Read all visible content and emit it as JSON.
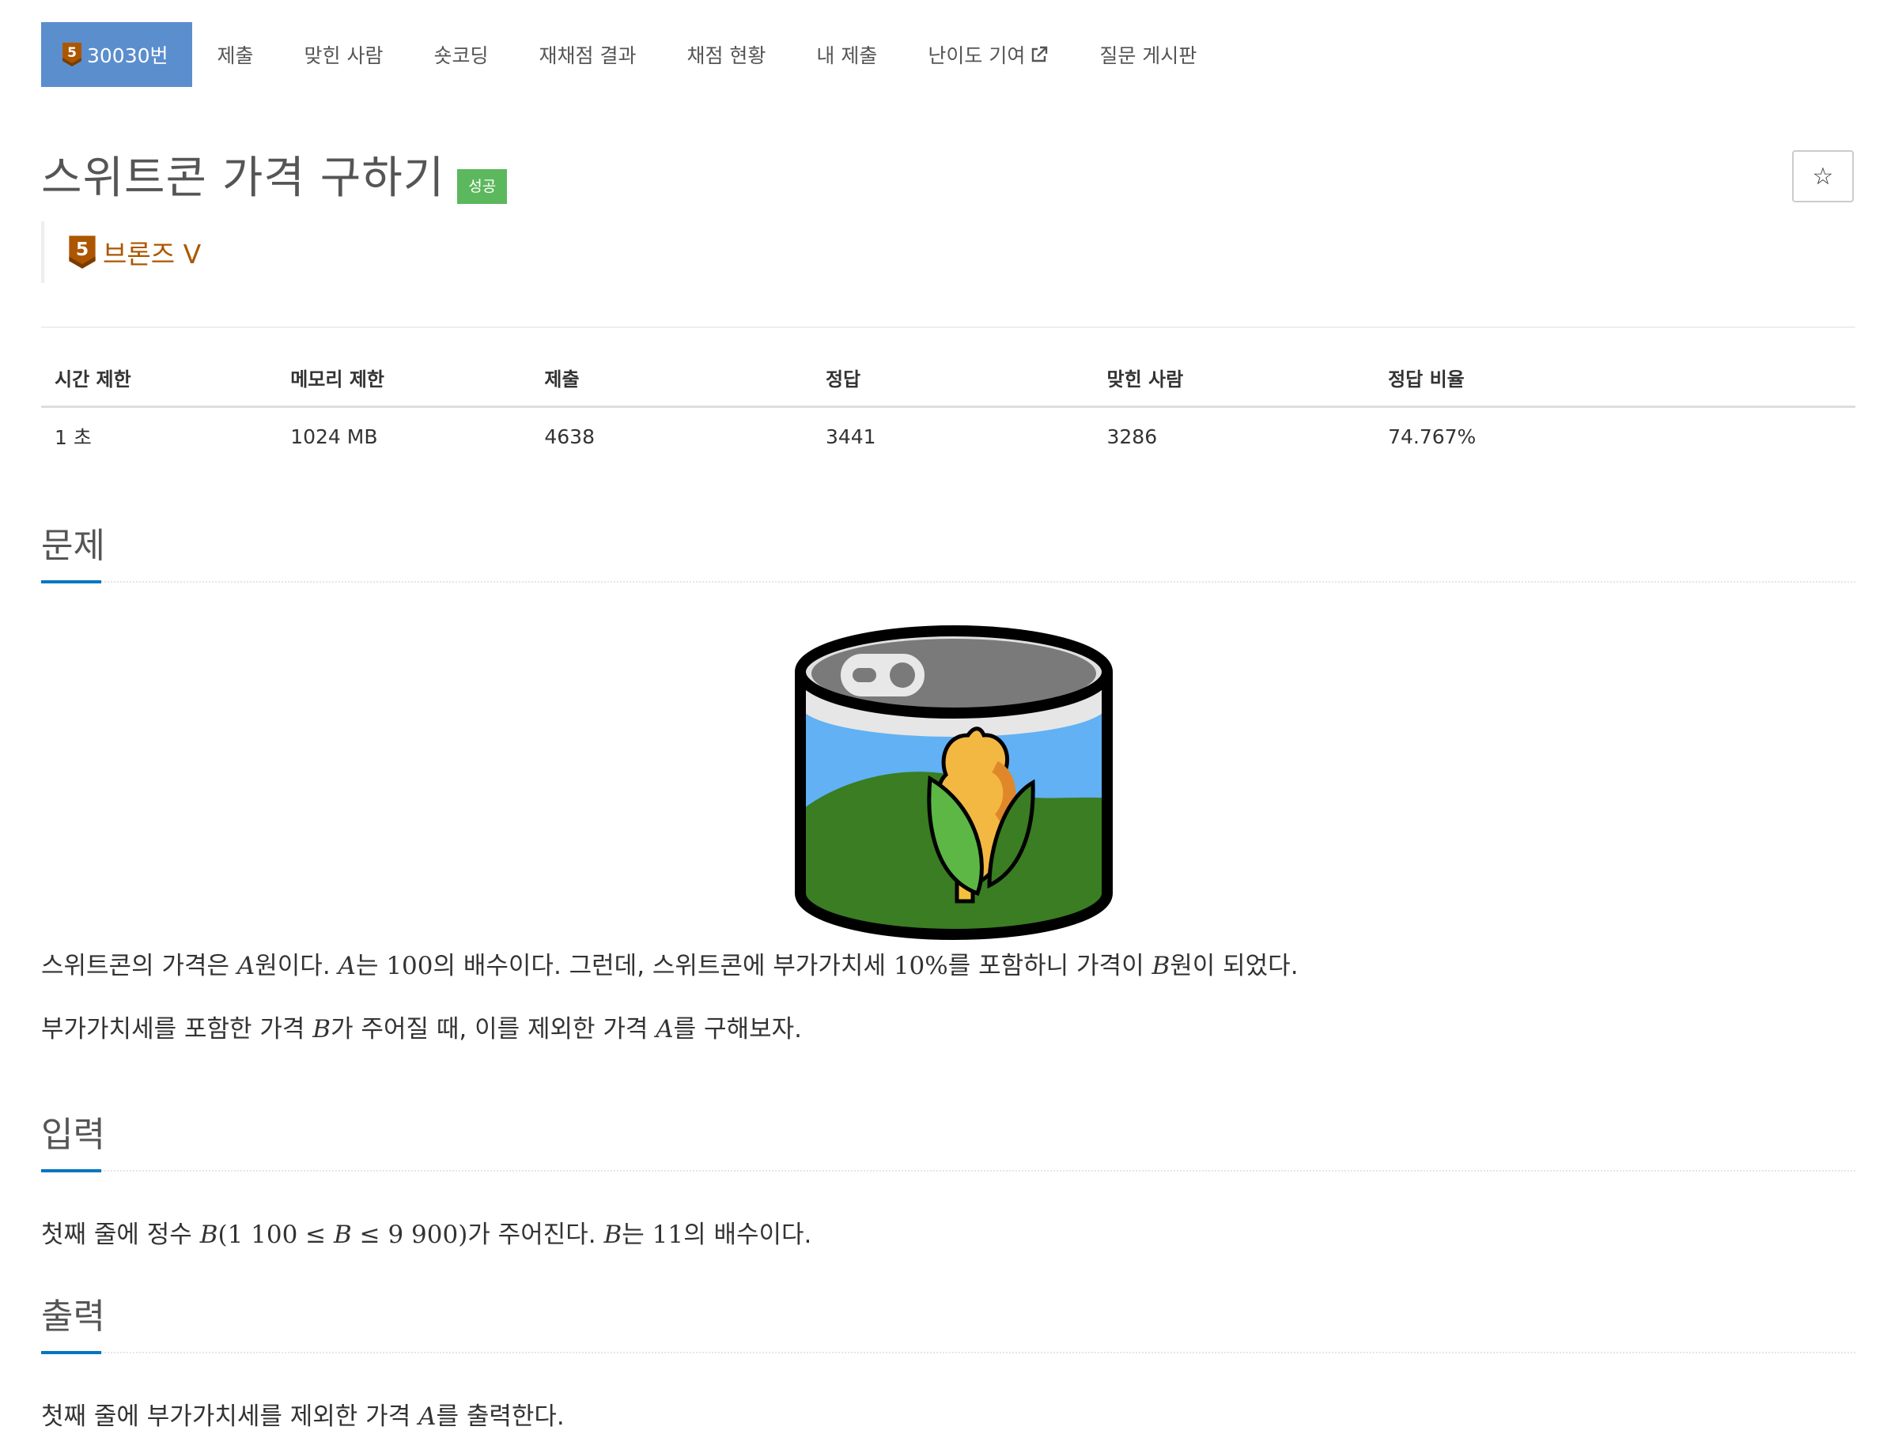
{
  "nav": {
    "problem_number": "30030번",
    "tier_badge_number": "5",
    "items": [
      "제출",
      "맞힌 사람",
      "숏코딩",
      "재채점 결과",
      "채점 현황",
      "내 제출",
      "난이도 기여",
      "질문 게시판"
    ]
  },
  "problem": {
    "title": "스위트콘 가격 구하기",
    "result_label": "성공",
    "tier_number": "5",
    "tier_name": "브론즈 V",
    "star_icon": "star-outline-icon"
  },
  "info_table": {
    "headers": [
      "시간 제한",
      "메모리 제한",
      "제출",
      "정답",
      "맞힌 사람",
      "정답 비율"
    ],
    "values": [
      "1 초",
      "1024 MB",
      "4638",
      "3441",
      "3286",
      "74.767%"
    ]
  },
  "sections": {
    "description_title": "문제",
    "input_title": "입력",
    "output_title": "출력"
  },
  "description": {
    "p1": [
      "스위트콘의 가격은 ",
      "A",
      "원이다. ",
      "A",
      "는 ",
      "100",
      "의 배수이다. 그런데, 스위트콘에 부가가치세 ",
      "10%",
      "를 포함하니 가격이 ",
      "B",
      "원이 되었다."
    ],
    "p2": [
      "부가가치세를 포함한 가격 ",
      "B",
      "가 주어질 때, 이를 제외한 가격 ",
      "A",
      "를 구해보자."
    ]
  },
  "input": {
    "p1": [
      "첫째 줄에 정수 ",
      "B",
      "(1 100 ≤ ",
      "B",
      " ≤ 9 900)",
      "가 주어진다. ",
      "B",
      "는 ",
      "11",
      "의 배수이다."
    ]
  },
  "output": {
    "p1": [
      "첫째 줄에 부가가치세를 제외한 가격 ",
      "A",
      "를 출력한다."
    ]
  },
  "colors": {
    "nav_active": "#5b8ecd",
    "result_success": "#5cb85c",
    "bronze": "#ad5600",
    "section_underline": "#0076c0"
  }
}
